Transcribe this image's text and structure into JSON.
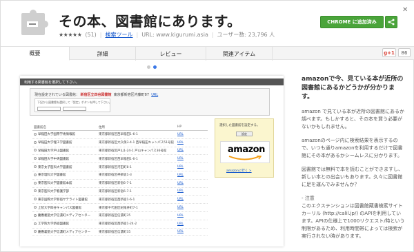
{
  "header": {
    "icon_name": "puzzle-extension-icon",
    "title": "その本、図書館にあります。",
    "stars": "★★★★★",
    "rating_count": "(51)",
    "category_link": "検索ツール",
    "url": "URL: www.kigurumi.asia",
    "users": "ユーザー数: 23,796 人",
    "install_label": "CHROME に追加済み",
    "accent_color": "#4aa43a"
  },
  "tabs": [
    {
      "label": "概要"
    },
    {
      "label": "詳細"
    },
    {
      "label": "レビュー"
    },
    {
      "label": "関連アイテム"
    }
  ],
  "social": {
    "gplus_label": "g+1",
    "count": "86"
  },
  "screenshot": {
    "bar_text": "利用する図書館を選択して下さい。",
    "lib_prefix": "現在設定されている図書館：",
    "lib_name": "新宿区立四谷図書館",
    "lib_address": "東京都新宿区内藤町87",
    "lib_url": "URL",
    "inner_text": "下記から図書館を選択して「設定」ボタンを押して下さい。",
    "headers": [
      "図書館名",
      "住所",
      "HP"
    ],
    "rows": [
      {
        "name": "早稲田大学国際学術情報館",
        "addr": "東京都新宿区西早稲田1-6-1",
        "hp": "URL"
      },
      {
        "name": "早稲田大学理工学図書館",
        "addr": "東京都新宿区大久保3-4-1 西早稲田キャンパス51号館",
        "hp": "URL"
      },
      {
        "name": "早稲田大学戸山図書館",
        "addr": "東京都新宿区戸山1-24-1 戸山キャンパス36号館",
        "hp": "URL"
      },
      {
        "name": "早稲田大学中央図書館",
        "addr": "東京都新宿区西早稲田1-6-1",
        "hp": "URL"
      },
      {
        "name": "東京女子医科大学図書館",
        "addr": "東京都新宿区河田町8-1",
        "hp": "URL"
      },
      {
        "name": "東京理科大学図書館",
        "addr": "東京都新宿区神楽坂1-3",
        "hp": "URL"
      },
      {
        "name": "東京医科大学図書館本館",
        "addr": "東京都新宿区新宿6-7-1",
        "hp": "URL"
      },
      {
        "name": "東京医科大学看護学部",
        "addr": "東京都新宿区新宿6-7-1",
        "hp": "URL"
      },
      {
        "name": "東京国際大学新宿サテライト図書館",
        "addr": "東京都新宿区西新宿1-6-1",
        "hp": "URL"
      },
      {
        "name": "上智大学四谷キャンパス図書館",
        "addr": "東京都千代田区紀尾井町7-1",
        "hp": "URL"
      },
      {
        "name": "慶應義塾大学信濃町メディアセンター",
        "addr": "東京都新宿区信濃町35",
        "hp": "URL"
      },
      {
        "name": "工学院大学新宿図書館",
        "addr": "東京都新宿区西新宿1-24-2",
        "hp": "URL"
      },
      {
        "name": "慶應義塾大学信濃町メディアセンター",
        "addr": "東京都新宿区信濃町35",
        "hp": "URL"
      }
    ],
    "panel_title": "選択した図書館を設定する。",
    "panel_button": "設定",
    "amazon_logo": "amazon",
    "amazon_link": "amazonに行く >"
  },
  "description": {
    "title": "amazonで今、見ている本が近所の図書館にあるかどうかが分かります。",
    "paragraphs": [
      "amazon で見ている本が近所の図書館にあるか調べます。もしかすると、その本を買う必要がないかもしれません。",
      "amazonのページ内に検索結果を表示するので、いつも通りamazonを利用するだけで図書館にその本があるかシームレスに分かります。",
      "図書館では無料で本を読むことができますし、新しい本との出会いもあります。久々に図書館に足を運んでみませんか？",
      "- 注意\nこのエクステンションは図書館蔵書検索サイト カーリル (http://calil.jp/) のAPIを利用しています。APIの仕様上で1000リクエスト/時という制限があるため、利用時間帯によっては検索が実行されない時があります。"
    ]
  }
}
